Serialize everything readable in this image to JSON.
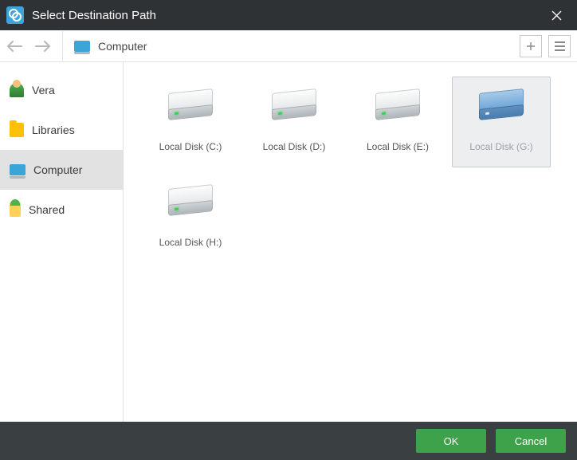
{
  "titlebar": {
    "title": "Select Destination Path"
  },
  "breadcrumb": {
    "location": "Computer"
  },
  "sidebar": {
    "items": [
      {
        "name": "vera",
        "label": "Vera",
        "icon": "user-icon"
      },
      {
        "name": "libraries",
        "label": "Libraries",
        "icon": "folder-icon"
      },
      {
        "name": "computer",
        "label": "Computer",
        "icon": "computer-icon",
        "selected": true
      },
      {
        "name": "shared",
        "label": "Shared",
        "icon": "shared-icon"
      }
    ]
  },
  "drives": [
    {
      "label": "Local Disk (C:)",
      "selected": false
    },
    {
      "label": "Local Disk (D:)",
      "selected": false
    },
    {
      "label": "Local Disk (E:)",
      "selected": false
    },
    {
      "label": "Local Disk (G:)",
      "selected": true
    },
    {
      "label": "Local Disk (H:)",
      "selected": false
    }
  ],
  "footer": {
    "ok_label": "OK",
    "cancel_label": "Cancel"
  }
}
